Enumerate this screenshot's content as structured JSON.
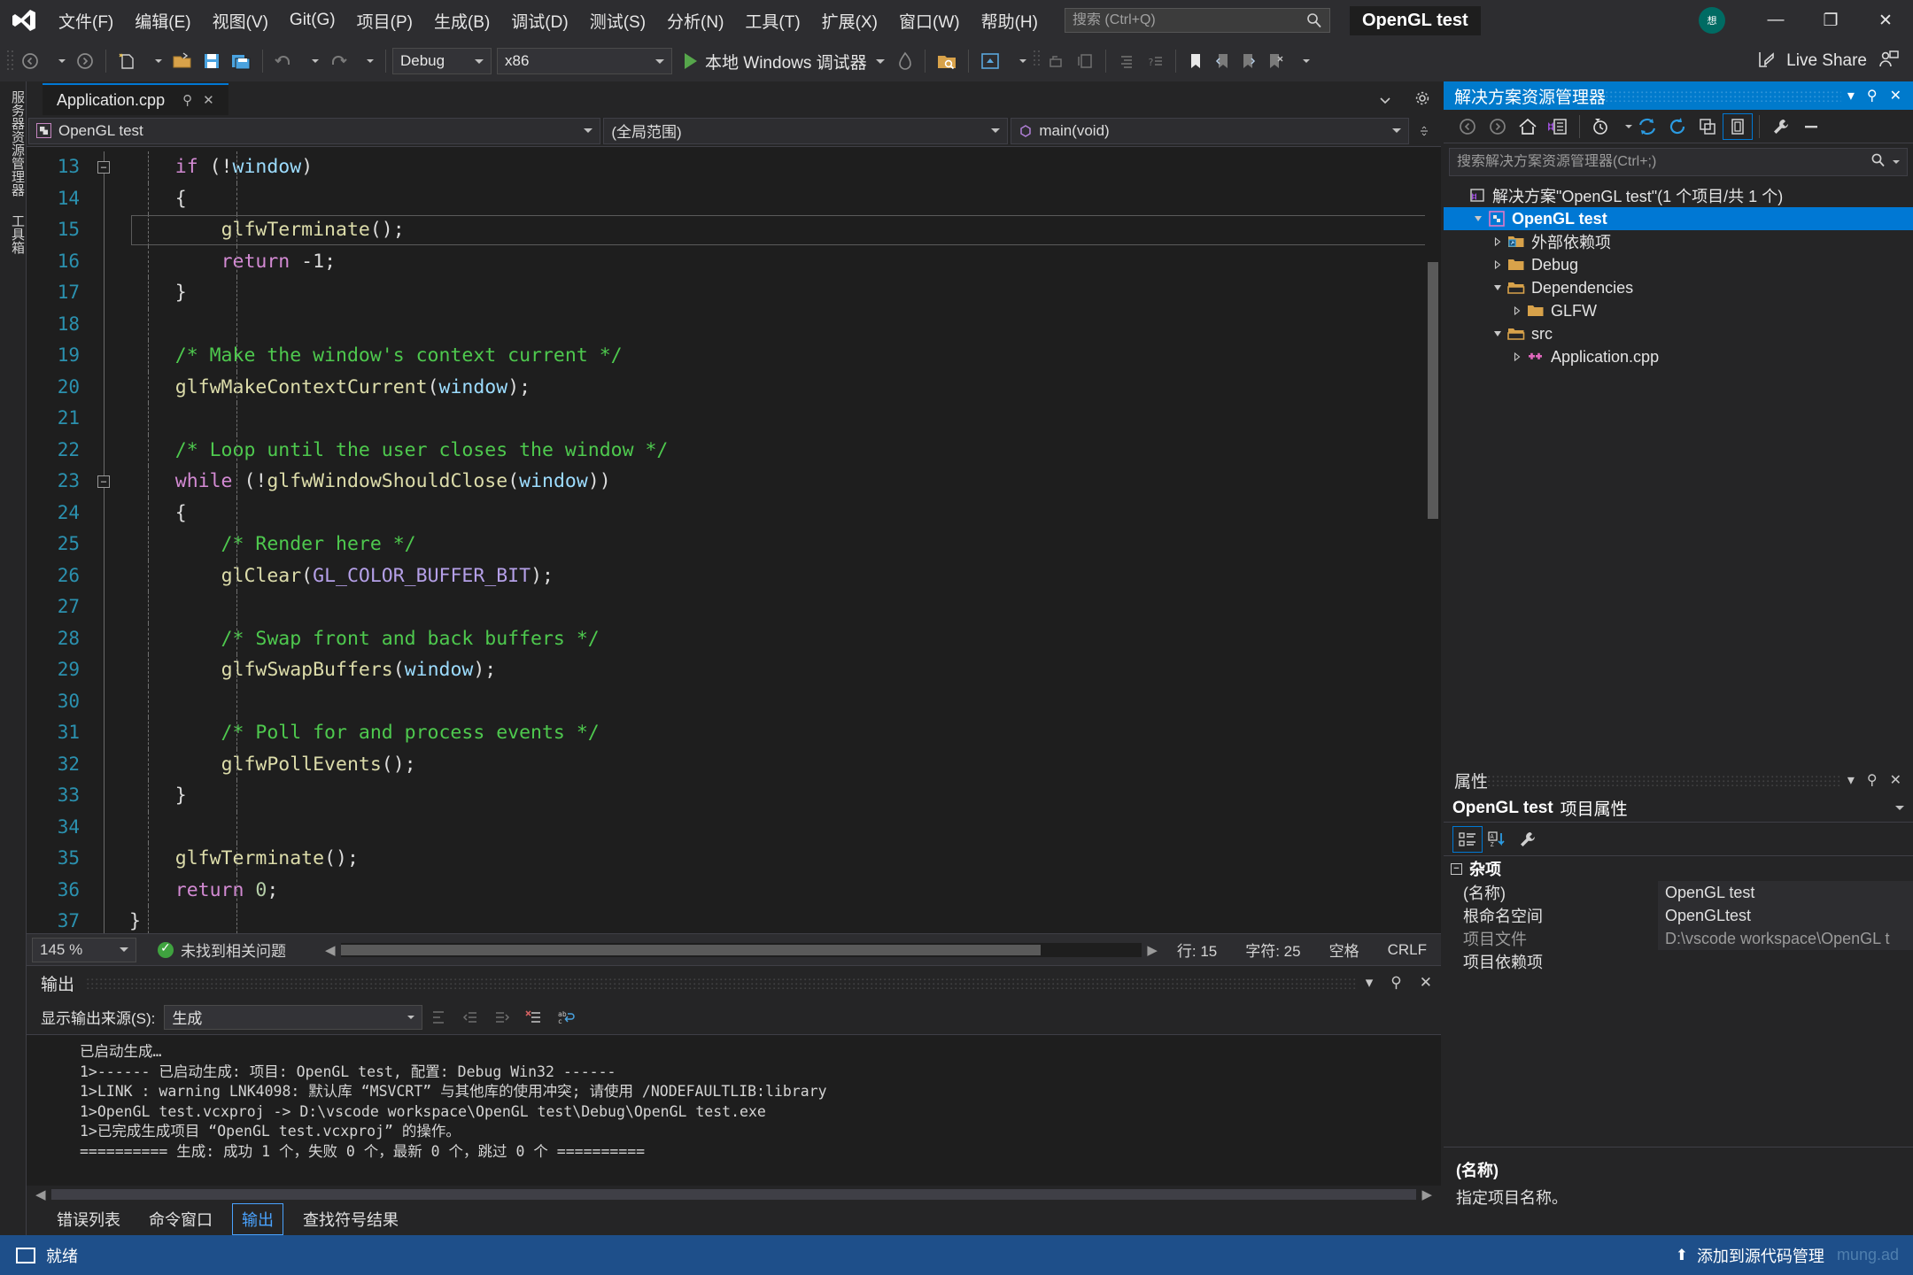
{
  "titlebar": {
    "menus": [
      "文件(F)",
      "编辑(E)",
      "视图(V)",
      "Git(G)",
      "项目(P)",
      "生成(B)",
      "调试(D)",
      "测试(S)",
      "分析(N)",
      "工具(T)",
      "扩展(X)",
      "窗口(W)",
      "帮助(H)"
    ],
    "search_placeholder": "搜索 (Ctrl+Q)",
    "search_value": "",
    "solution_name": "OpenGL test",
    "avatar_text": "想",
    "minimize": "—",
    "restore": "❐",
    "close": "✕"
  },
  "toolbar": {
    "config": "Debug",
    "platform": "x86",
    "run_label": "本地 Windows 调试器",
    "live_share": "Live Share"
  },
  "vertical_tabs": [
    "服务器资源管理器",
    "工具箱"
  ],
  "editor": {
    "tab_name": "Application.cpp",
    "tab_pin": "⚲",
    "tab_close": "✕",
    "nav_project": "OpenGL test",
    "nav_scope": "(全局范围)",
    "nav_member": "main(void)",
    "zoom": "145 %",
    "issue_status": "未找到相关问题",
    "line_label": "行: 15",
    "col_label": "字符: 25",
    "space_label": "空格",
    "eol_label": "CRLF",
    "code_lines": [
      {
        "n": 13,
        "fold": "minus",
        "tokens": [
          {
            "t": "    ",
            "c": "punct"
          },
          {
            "t": "if",
            "c": "kw"
          },
          {
            "t": " (!",
            "c": "punct"
          },
          {
            "t": "window",
            "c": "var"
          },
          {
            "t": ")",
            "c": "punct"
          }
        ]
      },
      {
        "n": 14,
        "fold": "",
        "tokens": [
          {
            "t": "    {",
            "c": "punct"
          }
        ]
      },
      {
        "n": 15,
        "fold": "",
        "highlight": true,
        "tokens": [
          {
            "t": "        ",
            "c": "punct"
          },
          {
            "t": "glfwTerminate",
            "c": "fn"
          },
          {
            "t": "();",
            "c": "punct"
          }
        ]
      },
      {
        "n": 16,
        "fold": "",
        "tokens": [
          {
            "t": "        ",
            "c": "punct"
          },
          {
            "t": "return",
            "c": "kw"
          },
          {
            "t": " -1;",
            "c": "punct"
          }
        ]
      },
      {
        "n": 17,
        "fold": "",
        "tokens": [
          {
            "t": "    }",
            "c": "punct"
          }
        ]
      },
      {
        "n": 18,
        "fold": "",
        "tokens": []
      },
      {
        "n": 19,
        "fold": "",
        "tokens": [
          {
            "t": "    /* Make the window's context current */",
            "c": "cmt"
          }
        ]
      },
      {
        "n": 20,
        "fold": "",
        "tokens": [
          {
            "t": "    ",
            "c": "punct"
          },
          {
            "t": "glfwMakeContextCurrent",
            "c": "fn"
          },
          {
            "t": "(",
            "c": "punct"
          },
          {
            "t": "window",
            "c": "var"
          },
          {
            "t": ");",
            "c": "punct"
          }
        ]
      },
      {
        "n": 21,
        "fold": "",
        "tokens": []
      },
      {
        "n": 22,
        "fold": "",
        "tokens": [
          {
            "t": "    /* Loop until the user closes the window */",
            "c": "cmt"
          }
        ]
      },
      {
        "n": 23,
        "fold": "minus",
        "tokens": [
          {
            "t": "    ",
            "c": "punct"
          },
          {
            "t": "while",
            "c": "kw"
          },
          {
            "t": " (!",
            "c": "punct"
          },
          {
            "t": "glfwWindowShouldClose",
            "c": "fn"
          },
          {
            "t": "(",
            "c": "punct"
          },
          {
            "t": "window",
            "c": "var"
          },
          {
            "t": "))",
            "c": "punct"
          }
        ]
      },
      {
        "n": 24,
        "fold": "",
        "tokens": [
          {
            "t": "    {",
            "c": "punct"
          }
        ]
      },
      {
        "n": 25,
        "fold": "",
        "tokens": [
          {
            "t": "        /* Render here */",
            "c": "cmt"
          }
        ]
      },
      {
        "n": 26,
        "fold": "",
        "tokens": [
          {
            "t": "        ",
            "c": "punct"
          },
          {
            "t": "glClear",
            "c": "fn"
          },
          {
            "t": "(",
            "c": "punct"
          },
          {
            "t": "GL_COLOR_BUFFER_BIT",
            "c": "mac"
          },
          {
            "t": ");",
            "c": "punct"
          }
        ]
      },
      {
        "n": 27,
        "fold": "",
        "tokens": []
      },
      {
        "n": 28,
        "fold": "",
        "tokens": [
          {
            "t": "        /* Swap front and back buffers */",
            "c": "cmt"
          }
        ]
      },
      {
        "n": 29,
        "fold": "",
        "tokens": [
          {
            "t": "        ",
            "c": "punct"
          },
          {
            "t": "glfwSwapBuffers",
            "c": "fn"
          },
          {
            "t": "(",
            "c": "punct"
          },
          {
            "t": "window",
            "c": "var"
          },
          {
            "t": ");",
            "c": "punct"
          }
        ]
      },
      {
        "n": 30,
        "fold": "",
        "tokens": []
      },
      {
        "n": 31,
        "fold": "",
        "tokens": [
          {
            "t": "        /* Poll for and process events */",
            "c": "cmt"
          }
        ]
      },
      {
        "n": 32,
        "fold": "",
        "tokens": [
          {
            "t": "        ",
            "c": "punct"
          },
          {
            "t": "glfwPollEvents",
            "c": "fn"
          },
          {
            "t": "();",
            "c": "punct"
          }
        ]
      },
      {
        "n": 33,
        "fold": "",
        "tokens": [
          {
            "t": "    }",
            "c": "punct"
          }
        ]
      },
      {
        "n": 34,
        "fold": "",
        "tokens": []
      },
      {
        "n": 35,
        "fold": "",
        "tokens": [
          {
            "t": "    ",
            "c": "punct"
          },
          {
            "t": "glfwTerminate",
            "c": "fn"
          },
          {
            "t": "();",
            "c": "punct"
          }
        ]
      },
      {
        "n": 36,
        "fold": "",
        "tokens": [
          {
            "t": "    ",
            "c": "punct"
          },
          {
            "t": "return",
            "c": "kw"
          },
          {
            "t": " ",
            "c": "punct"
          },
          {
            "t": "0",
            "c": "num"
          },
          {
            "t": ";",
            "c": "punct"
          }
        ]
      },
      {
        "n": 37,
        "fold": "",
        "tokens": [
          {
            "t": "}",
            "c": "punct"
          }
        ]
      }
    ]
  },
  "output": {
    "title": "输出",
    "source_label": "显示输出来源(S):",
    "source_value": "生成",
    "lines": [
      "已启动生成…",
      "1>------ 已启动生成: 项目: OpenGL test, 配置: Debug Win32 ------",
      "1>LINK : warning LNK4098: 默认库 “MSVCRT” 与其他库的使用冲突; 请使用 /NODEFAULTLIB:library",
      "1>OpenGL test.vcxproj -> D:\\vscode workspace\\OpenGL test\\Debug\\OpenGL test.exe",
      "1>已完成生成项目 “OpenGL test.vcxproj” 的操作。",
      "========== 生成: 成功 1 个，失败 0 个，最新 0 个，跳过 0 个 =========="
    ],
    "tabs": [
      {
        "label": "错误列表",
        "active": false
      },
      {
        "label": "命令窗口",
        "active": false
      },
      {
        "label": "输出",
        "active": true
      },
      {
        "label": "查找符号结果",
        "active": false
      }
    ]
  },
  "solution_explorer": {
    "title": "解决方案资源管理器",
    "search_placeholder": "搜索解决方案资源管理器(Ctrl+;)",
    "search_value": "",
    "tree": [
      {
        "label": "解决方案\"OpenGL test\"(1 个项目/共 1 个)",
        "depth": 0,
        "icon": "solution",
        "expander": "",
        "selected": false
      },
      {
        "label": "OpenGL test",
        "depth": 1,
        "icon": "project",
        "expander": "open",
        "selected": true
      },
      {
        "label": "外部依赖项",
        "depth": 2,
        "icon": "ext-folder",
        "expander": "closed",
        "selected": false
      },
      {
        "label": "Debug",
        "depth": 2,
        "icon": "folder",
        "expander": "closed",
        "selected": false
      },
      {
        "label": "Dependencies",
        "depth": 2,
        "icon": "folder-open",
        "expander": "open",
        "selected": false
      },
      {
        "label": "GLFW",
        "depth": 3,
        "icon": "folder",
        "expander": "closed",
        "selected": false
      },
      {
        "label": "src",
        "depth": 2,
        "icon": "folder-open",
        "expander": "open",
        "selected": false
      },
      {
        "label": "Application.cpp",
        "depth": 3,
        "icon": "cpp",
        "expander": "closed",
        "selected": false
      }
    ]
  },
  "properties": {
    "title": "属性",
    "subtitle_bold": "OpenGL test",
    "subtitle_rest": "项目属性",
    "group": "杂项",
    "rows": [
      {
        "key": "(名称)",
        "value": "OpenGL test",
        "dim": false
      },
      {
        "key": "根命名空间",
        "value": "OpenGLtest",
        "dim": false
      },
      {
        "key": "项目文件",
        "value": "D:\\vscode workspace\\OpenGL t",
        "dim": true
      },
      {
        "key": "项目依赖项",
        "value": "",
        "dim": false
      }
    ],
    "desc_title": "(名称)",
    "desc_body": "指定项目名称。"
  },
  "statusbar": {
    "status": "就绪",
    "source_control": "添加到源代码管理",
    "watermark": "mung.ad"
  }
}
